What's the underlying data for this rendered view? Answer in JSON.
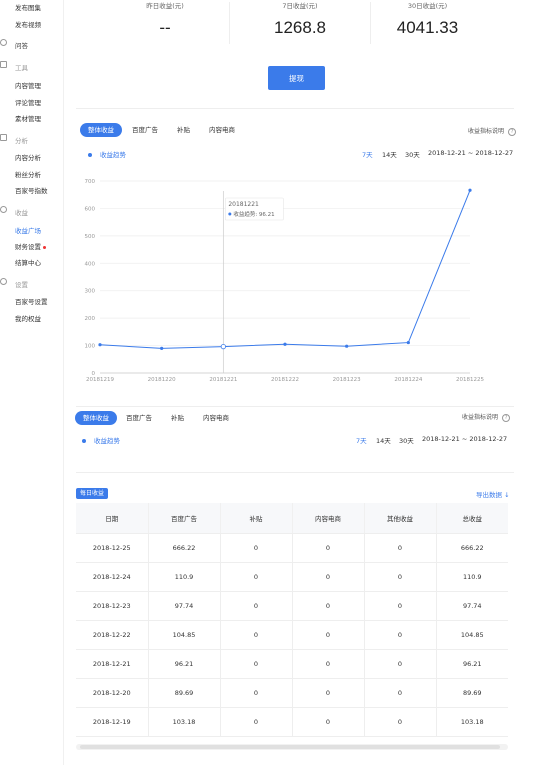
{
  "sidebar": {
    "top_items": [
      "发布图集",
      "发布视频"
    ],
    "qa": "问答",
    "tools_head": "工具",
    "tools": [
      "内容管理",
      "评论管理",
      "素材管理"
    ],
    "analysis_head": "分析",
    "analysis": [
      "内容分析",
      "粉丝分析",
      "百家号指数"
    ],
    "income_head": "收益",
    "income": [
      "收益广场",
      "财务设置",
      "结算中心"
    ],
    "settings_head": "设置",
    "settings": [
      "百家号设置",
      "我的权益"
    ]
  },
  "stats": {
    "yesterday_label": "昨日收益(元)",
    "yesterday_value": "--",
    "week_label": "7日收益(元)",
    "week_value": "1268.8",
    "month_label": "30日收益(元)",
    "month_value": "4041.33"
  },
  "withdraw_label": "提现",
  "tabs": [
    "整体收益",
    "百度广告",
    "补贴",
    "内容电商"
  ],
  "explain_label": "收益指标说明",
  "legend_label": "收益趋势",
  "range_options": [
    "7天",
    "14天",
    "30天"
  ],
  "date_range": "2018-12-21 ~ 2018-12-27",
  "tooltip": {
    "date": "20181221",
    "text": "收益趋势: 96.21"
  },
  "chart_data": {
    "type": "line",
    "categories": [
      "20181219",
      "20181220",
      "20181221",
      "20181222",
      "20181223",
      "20181224",
      "20181225"
    ],
    "series": [
      {
        "values": [
          103.18,
          89.69,
          96.21,
          104.85,
          97.74,
          110.9,
          666.22
        ]
      }
    ],
    "yticks": [
      0,
      100,
      200,
      300,
      400,
      500,
      600,
      700
    ],
    "ylim": [
      0,
      700
    ],
    "grid": true,
    "highlight_index": 2,
    "color": "#3b7bea"
  },
  "section2": {
    "tabs": [
      "整体收益",
      "百度广告",
      "补贴",
      "内容电商"
    ],
    "explain_label": "收益指标说明",
    "legend_label": "收益趋势",
    "range_options": [
      "7天",
      "14天",
      "30天"
    ],
    "date_range": "2018-12-21 ~ 2018-12-27"
  },
  "daily": {
    "badge": "每日收益",
    "export": "导出数据 ↓",
    "columns": [
      "日期",
      "百度广告",
      "补贴",
      "内容电商",
      "其他收益",
      "总收益"
    ],
    "rows": [
      [
        "2018-12-25",
        "666.22",
        "0",
        "0",
        "0",
        "666.22"
      ],
      [
        "2018-12-24",
        "110.9",
        "0",
        "0",
        "0",
        "110.9"
      ],
      [
        "2018-12-23",
        "97.74",
        "0",
        "0",
        "0",
        "97.74"
      ],
      [
        "2018-12-22",
        "104.85",
        "0",
        "0",
        "0",
        "104.85"
      ],
      [
        "2018-12-21",
        "96.21",
        "0",
        "0",
        "0",
        "96.21"
      ],
      [
        "2018-12-20",
        "89.69",
        "0",
        "0",
        "0",
        "89.69"
      ],
      [
        "2018-12-19",
        "103.18",
        "0",
        "0",
        "0",
        "103.18"
      ]
    ]
  }
}
